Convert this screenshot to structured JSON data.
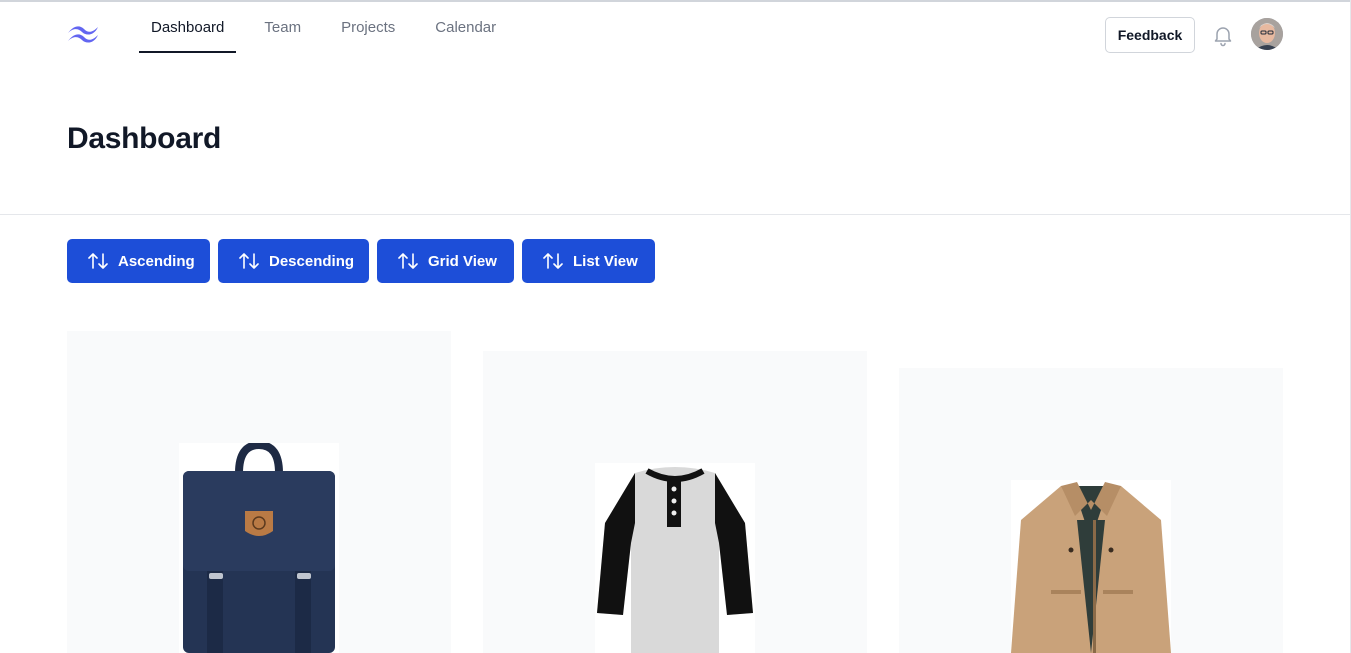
{
  "nav": {
    "tabs": [
      {
        "label": "Dashboard",
        "active": true
      },
      {
        "label": "Team",
        "active": false
      },
      {
        "label": "Projects",
        "active": false
      },
      {
        "label": "Calendar",
        "active": false
      }
    ],
    "feedback_label": "Feedback",
    "logo_icon": "wave-logo-icon",
    "notification_icon": "bell-icon"
  },
  "header": {
    "title": "Dashboard"
  },
  "toolbar": {
    "buttons": [
      {
        "label": "Ascending",
        "icon": "sort-arrows-icon"
      },
      {
        "label": "Descending",
        "icon": "sort-arrows-icon"
      },
      {
        "label": "Grid View",
        "icon": "sort-arrows-icon"
      },
      {
        "label": "List View",
        "icon": "sort-arrows-icon"
      }
    ]
  },
  "products": [
    {
      "image": "navy backpack"
    },
    {
      "image": "raglan henley t-shirt"
    },
    {
      "image": "khaki jacket"
    }
  ],
  "colors": {
    "accent": "#1d4ed8",
    "logo": "#6366f1",
    "card_bg": "#f9fafb"
  }
}
